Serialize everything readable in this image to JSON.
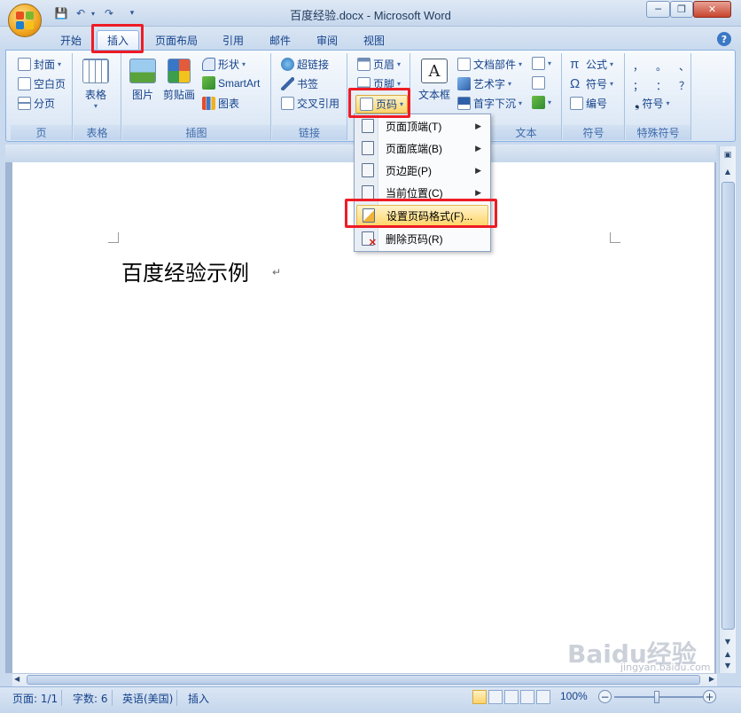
{
  "window": {
    "title": "百度经验.docx - Microsoft Word",
    "minimize": "─",
    "restore": "❐",
    "close": "✕"
  },
  "qat": {
    "save": "💾",
    "undo": "↶",
    "redo": "↷",
    "customize": "▾"
  },
  "tabs": [
    "开始",
    "插入",
    "页面布局",
    "引用",
    "邮件",
    "审阅",
    "视图"
  ],
  "active_tab": "插入",
  "help": "?",
  "ribbon": {
    "groups": {
      "page": {
        "label": "页",
        "items": [
          "封面",
          "空白页",
          "分页"
        ]
      },
      "table": {
        "label": "表格",
        "button": "表格"
      },
      "illustrations": {
        "label": "插图",
        "picture": "图片",
        "clipart": "剪贴画",
        "shapes": "形状",
        "smartart": "SmartArt",
        "chart": "图表"
      },
      "links": {
        "label": "链接",
        "hyperlink": "超链接",
        "bookmark": "书签",
        "crossref": "交叉引用"
      },
      "header_footer": {
        "header": "页眉",
        "footer": "页脚",
        "page_number": "页码"
      },
      "text": {
        "label": "文本",
        "textbox": "文本框",
        "quickparts": "文档部件",
        "wordart": "艺术字",
        "dropcap": "首字下沉"
      },
      "symbols": {
        "label": "符号",
        "equation": "公式",
        "symbol": "符号",
        "number": "编号"
      },
      "special": {
        "label": "特殊符号",
        "symbol": "符号",
        "row1": [
          "，",
          "。",
          "、"
        ],
        "row2": [
          "；",
          "：",
          "？"
        ]
      }
    }
  },
  "page_number_menu": {
    "items": [
      {
        "label": "页面顶端(T)",
        "submenu": true
      },
      {
        "label": "页面底端(B)",
        "submenu": true
      },
      {
        "label": "页边距(P)",
        "submenu": true
      },
      {
        "label": "当前位置(C)",
        "submenu": true
      },
      {
        "label": "设置页码格式(F)...",
        "submenu": false
      },
      {
        "label": "删除页码(R)",
        "submenu": false
      }
    ],
    "highlighted_index": 4
  },
  "document": {
    "text": "百度经验示例",
    "paragraph_mark": "↵"
  },
  "status": {
    "page": "页面: 1/1",
    "words": "字数: 6",
    "language": "英语(美国)",
    "mode": "插入",
    "zoom": "100%"
  },
  "watermark": {
    "brand": "Baidu经验",
    "url": "jingyan.baidu.com"
  }
}
